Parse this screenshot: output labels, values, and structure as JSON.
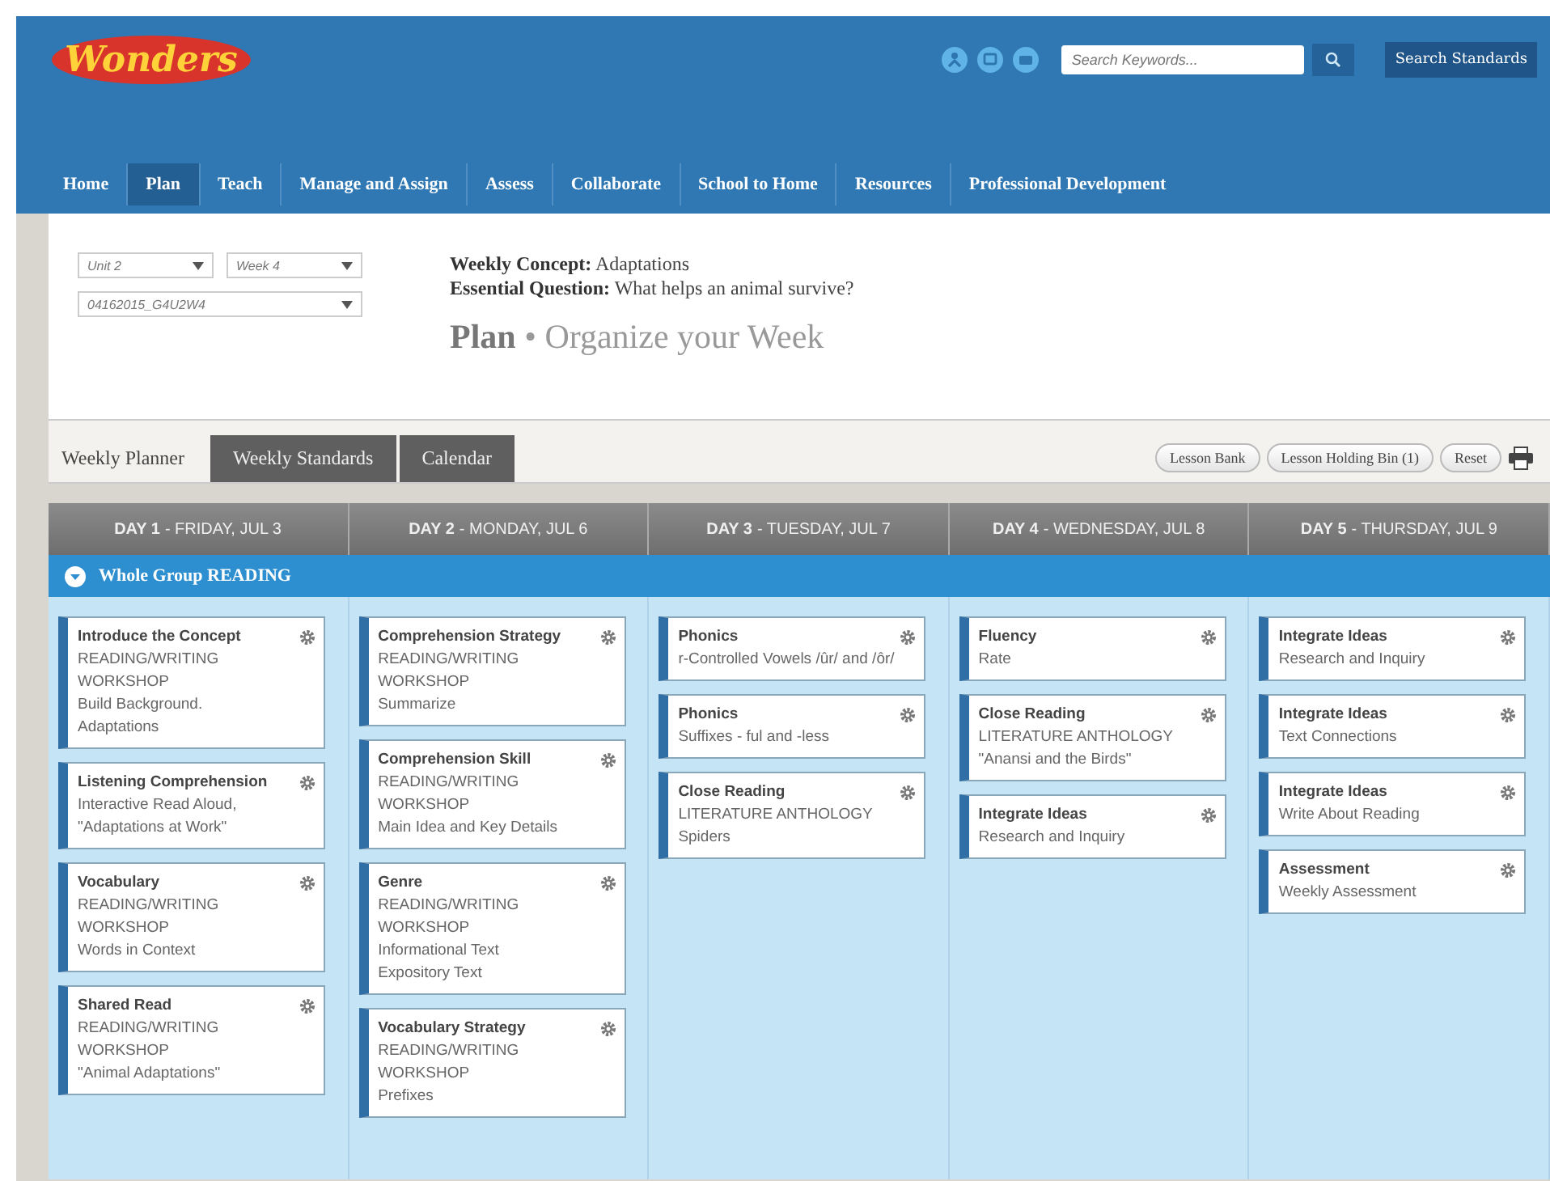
{
  "header": {
    "logo": "Wonders",
    "search": {
      "placeholder": "Search Keywords..."
    },
    "search_standards": "Search Standards"
  },
  "nav": [
    {
      "label": "Home",
      "selected": false
    },
    {
      "label": "Plan",
      "selected": true
    },
    {
      "label": "Teach",
      "selected": false
    },
    {
      "label": "Manage and Assign",
      "selected": false
    },
    {
      "label": "Assess",
      "selected": false
    },
    {
      "label": "Collaborate",
      "selected": false
    },
    {
      "label": "School to Home",
      "selected": false
    },
    {
      "label": "Resources",
      "selected": false
    },
    {
      "label": "Professional Development",
      "selected": false
    }
  ],
  "selectors": {
    "unit": "Unit 2",
    "week": "Week 4",
    "plan": "04162015_G4U2W4"
  },
  "concept": {
    "weekly_label": "Weekly Concept:",
    "weekly_value": "Adaptations",
    "question_label": "Essential Question:",
    "question_value": "What helps an animal survive?"
  },
  "page_title": "**Plan** • Organize your Week",
  "tabs": [
    {
      "label": "Weekly Planner",
      "selected": true
    },
    {
      "label": "Weekly Standards",
      "selected": false
    },
    {
      "label": "Calendar",
      "selected": false
    }
  ],
  "actions": [
    "Lesson Bank",
    "Lesson Holding Bin (1)",
    "Reset"
  ],
  "days": [
    {
      "day": "DAY 1",
      "date": "- FRIDAY, JUL 3"
    },
    {
      "day": "DAY 2",
      "date": "- MONDAY, JUL 6"
    },
    {
      "day": "DAY 3",
      "date": "- TUESDAY, JUL 7"
    },
    {
      "day": "DAY 4",
      "date": "- WEDNESDAY, JUL 8"
    },
    {
      "day": "DAY 5",
      "date": "- THURSDAY, JUL 9"
    }
  ],
  "group": {
    "label": "Whole Group READING",
    "expanded": true
  },
  "columns": [
    [
      {
        "title": "Introduce the Concept",
        "lines": [
          "READING/WRITING WORKSHOP",
          "Build Background.",
          "Adaptations"
        ]
      },
      {
        "title": "Listening Comprehension",
        "lines": [
          "Interactive Read Aloud,",
          "\"Adaptations at Work\""
        ]
      },
      {
        "title": "Vocabulary",
        "lines": [
          "READING/WRITING WORKSHOP",
          "Words in Context"
        ]
      },
      {
        "title": "Shared Read",
        "lines": [
          "READING/WRITING WORKSHOP",
          "\"Animal Adaptations\""
        ]
      }
    ],
    [
      {
        "title": "Comprehension Strategy",
        "lines": [
          "READING/WRITING WORKSHOP",
          "Summarize"
        ]
      },
      {
        "title": "Comprehension Skill",
        "lines": [
          "READING/WRITING WORKSHOP",
          "Main Idea and Key Details"
        ]
      },
      {
        "title": "Genre",
        "lines": [
          "READING/WRITING WORKSHOP",
          "Informational Text",
          "Expository Text"
        ]
      },
      {
        "title": "Vocabulary Strategy",
        "lines": [
          "READING/WRITING WORKSHOP",
          "Prefixes"
        ]
      }
    ],
    [
      {
        "title": "Phonics",
        "lines": [
          "r-Controlled Vowels /ûr/ and /ôr/"
        ]
      },
      {
        "title": "Phonics",
        "lines": [
          "Suffixes - ful and -less"
        ]
      },
      {
        "title": "Close Reading",
        "lines": [
          "LITERATURE ANTHOLOGY",
          "Spiders"
        ]
      }
    ],
    [
      {
        "title": "Fluency",
        "lines": [
          "Rate"
        ]
      },
      {
        "title": "Close Reading",
        "lines": [
          "LITERATURE ANTHOLOGY",
          "\"Anansi and the Birds\""
        ]
      },
      {
        "title": "Integrate Ideas",
        "lines": [
          "Research and Inquiry"
        ]
      }
    ],
    [
      {
        "title": "Integrate Ideas",
        "lines": [
          "Research and Inquiry"
        ]
      },
      {
        "title": "Integrate Ideas",
        "lines": [
          "Text Connections"
        ]
      },
      {
        "title": "Integrate Ideas",
        "lines": [
          "Write About Reading"
        ]
      },
      {
        "title": "Assessment",
        "lines": [
          "Weekly Assessment"
        ]
      }
    ]
  ]
}
